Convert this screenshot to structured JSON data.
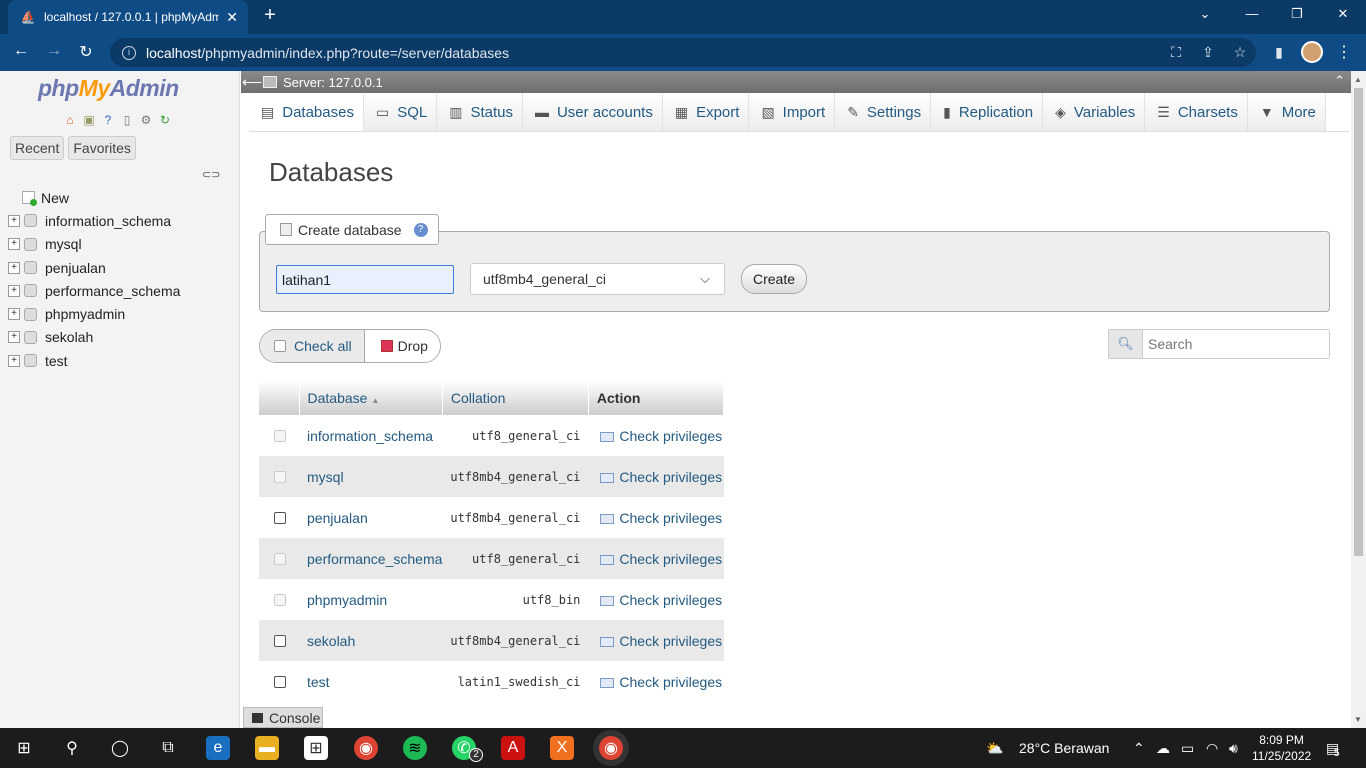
{
  "browser": {
    "tab_title": "localhost / 127.0.0.1 | phpMyAdm",
    "url_host": "localhost",
    "url_path": "/phpmyadmin/index.php?route=/server/databases"
  },
  "sidebar": {
    "logo_php": "php",
    "logo_my": "My",
    "logo_admin": "Admin",
    "recent_label": "Recent",
    "favorites_label": "Favorites",
    "tree": [
      {
        "label": "New"
      },
      {
        "label": "information_schema"
      },
      {
        "label": "mysql"
      },
      {
        "label": "penjualan"
      },
      {
        "label": "performance_schema"
      },
      {
        "label": "phpmyadmin"
      },
      {
        "label": "sekolah"
      },
      {
        "label": "test"
      }
    ]
  },
  "server_bar": {
    "label": "Server: 127.0.0.1"
  },
  "tabs": [
    {
      "label": "Databases",
      "icon": "database-icon"
    },
    {
      "label": "SQL",
      "icon": "sql-icon"
    },
    {
      "label": "Status",
      "icon": "status-icon"
    },
    {
      "label": "User accounts",
      "icon": "users-icon"
    },
    {
      "label": "Export",
      "icon": "export-icon"
    },
    {
      "label": "Import",
      "icon": "import-icon"
    },
    {
      "label": "Settings",
      "icon": "wrench-icon"
    },
    {
      "label": "Replication",
      "icon": "replication-icon"
    },
    {
      "label": "Variables",
      "icon": "variables-icon"
    },
    {
      "label": "Charsets",
      "icon": "charsets-icon"
    },
    {
      "label": "More",
      "icon": "more-icon"
    }
  ],
  "page_title": "Databases",
  "create_db": {
    "legend": "Create database",
    "name_value": "latihan1",
    "collation_value": "utf8mb4_general_ci",
    "create_label": "Create"
  },
  "bulk": {
    "check_all_label": "Check all",
    "drop_label": "Drop"
  },
  "search": {
    "placeholder": "Search"
  },
  "table": {
    "headers": {
      "database": "Database",
      "collation": "Collation",
      "action": "Action"
    },
    "rows": [
      {
        "db": "information_schema",
        "collation": "utf8_general_ci",
        "action": "Check privileges",
        "disabled": true
      },
      {
        "db": "mysql",
        "collation": "utf8mb4_general_ci",
        "action": "Check privileges",
        "disabled": true
      },
      {
        "db": "penjualan",
        "collation": "utf8mb4_general_ci",
        "action": "Check privileges",
        "disabled": false
      },
      {
        "db": "performance_schema",
        "collation": "utf8_general_ci",
        "action": "Check privileges",
        "disabled": true
      },
      {
        "db": "phpmyadmin",
        "collation": "utf8_bin",
        "action": "Check privileges",
        "disabled": true
      },
      {
        "db": "sekolah",
        "collation": "utf8mb4_general_ci",
        "action": "Check privileges",
        "disabled": false
      },
      {
        "db": "test",
        "collation": "latin1_swedish_ci",
        "action": "Check privileges",
        "disabled": false
      }
    ]
  },
  "console": {
    "label": "Console"
  },
  "taskbar": {
    "weather": "28°C  Berawan",
    "time": "8:09 PM",
    "date": "11/25/2022",
    "whatsapp_badge": "2",
    "notif_count": "5"
  }
}
